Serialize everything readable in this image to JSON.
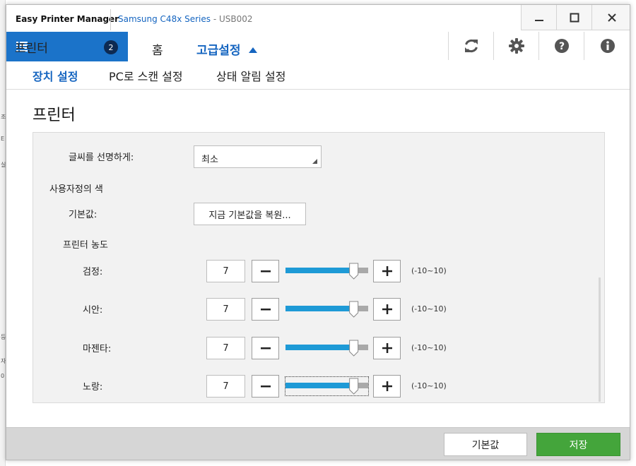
{
  "window": {
    "app_name": "Easy Printer Manager",
    "printer_name": "Samsung C48x Series",
    "printer_port": " - USB002",
    "buttons": [
      "minimize",
      "maximize",
      "close"
    ]
  },
  "nav": {
    "printer_tab": {
      "label": "프린터",
      "badge": "2",
      "icon": "list-icon"
    },
    "home": "홈",
    "advanced": "고급설정",
    "tools": [
      "refresh-icon",
      "gear-icon",
      "help-icon",
      "info-icon"
    ]
  },
  "subtabs": [
    {
      "label": "장치 설정",
      "active": true
    },
    {
      "label": "PC로 스캔 설정",
      "active": false
    },
    {
      "label": "상태 알림 설정",
      "active": false
    }
  ],
  "section_title": "프린터",
  "settings": {
    "sharpen_label": "글씨를 선명하게:",
    "sharpen_value": "최소",
    "custom_color_label": "사용자정의 색",
    "default_label": "기본값:",
    "restore_button": "지금 기본값을 복원...",
    "density_label": "프린터 농도",
    "density_rows": [
      {
        "label": "검정:",
        "value": "7",
        "min": -10,
        "max": 10,
        "range_text": "(-10~10)",
        "focused": false
      },
      {
        "label": "시안:",
        "value": "7",
        "min": -10,
        "max": 10,
        "range_text": "(-10~10)",
        "focused": false
      },
      {
        "label": "마젠타:",
        "value": "7",
        "min": -10,
        "max": 10,
        "range_text": "(-10~10)",
        "focused": false
      },
      {
        "label": "노랑:",
        "value": "7",
        "min": -10,
        "max": 10,
        "range_text": "(-10~10)",
        "focused": true
      }
    ]
  },
  "footer": {
    "default_button": "기본값",
    "save_button": "저장"
  },
  "colors": {
    "accent": "#1b73c9",
    "slider_fill": "#1e9ad6",
    "save": "#44a53b"
  }
}
